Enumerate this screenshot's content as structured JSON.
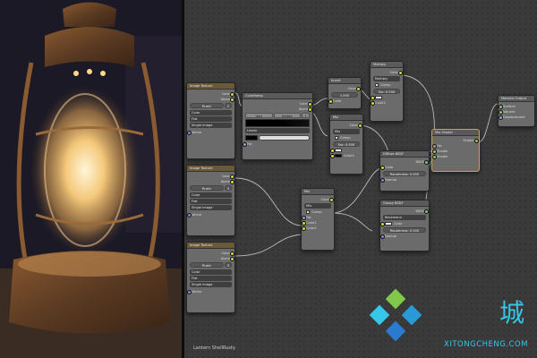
{
  "colors": {
    "editor_bg": "#3a3a3a",
    "node_body": "#6b6b6b",
    "socket_color": "#d8d83b",
    "socket_shader": "#8ac57a",
    "socket_vector": "#7a8ad8",
    "active_outline": "#e19a3a",
    "wire": "#cfcfcf",
    "watermark": "#35c6e8"
  },
  "icons": {
    "photo": "oil-lantern-photo",
    "logo": "xitongcheng-diamond-logo"
  },
  "frame_label": "Lantern ShellRusty",
  "nodes": {
    "image_texture_1": {
      "title": "Image Texture",
      "outputs": [
        "Color",
        "Alpha"
      ],
      "image_field": "Rusty",
      "count": "2",
      "selects": [
        "Color",
        "Flat",
        "Single Image"
      ],
      "input": "Vector"
    },
    "image_texture_2": {
      "title": "Image Texture",
      "outputs": [
        "Color",
        "Alpha"
      ],
      "image_field": "Rusty",
      "count": "3",
      "selects": [
        "Color",
        "Flat",
        "Single Image"
      ],
      "input": "Vector"
    },
    "image_texture_3": {
      "title": "Image Texture",
      "outputs": [
        "Color",
        "Alpha"
      ],
      "image_field": "Rusty",
      "count": "3",
      "selects": [
        "Color",
        "Flat",
        "Single Image"
      ],
      "input": "Vector"
    },
    "color_ramp": {
      "title": "ColorRamp",
      "outputs": [
        "Color",
        "Alpha"
      ],
      "add": "Add",
      "delete": "Delete",
      "flip": "F",
      "interp": "Linear",
      "input": "Fac"
    },
    "invert": {
      "title": "Invert",
      "output": "Color",
      "fac": "1.000",
      "input": "Color"
    },
    "mix_top": {
      "title": "Mix",
      "output": "Color",
      "mode": "Mix",
      "clamp": "Clamp",
      "fac": "Fac: 0.550",
      "inputs": [
        "Color1",
        "Color2"
      ]
    },
    "multiply": {
      "title": "Multiply",
      "output": "Color",
      "mode": "Multiply",
      "clamp": "Clamp",
      "fac": "Fac: 0.550",
      "inputs": [
        "Color1",
        "Color2"
      ]
    },
    "mix_bottom": {
      "title": "Mix",
      "output": "Color",
      "mode": "Mix",
      "clamp": "Clamp",
      "inputs": [
        "Fac",
        "Color1",
        "Color2"
      ]
    },
    "diffuse": {
      "title": "Diffuse BSDF",
      "output": "BSDF",
      "roughness": "Roughness: 0.000",
      "inputs": [
        "Color",
        "Normal"
      ]
    },
    "glossy": {
      "title": "Glossy BSDF",
      "output": "BSDF",
      "mode": "Beckmann",
      "roughness": "Roughness: 0.200",
      "inputs": [
        "Color",
        "Normal"
      ]
    },
    "mix_shader": {
      "title": "Mix Shader",
      "output": "Shader",
      "inputs": [
        "Fac",
        "Shader",
        "Shader"
      ]
    },
    "material_output": {
      "title": "Material Output",
      "inputs": [
        "Surface",
        "Volume",
        "Displacement"
      ]
    }
  },
  "watermark": {
    "char": "城",
    "text": "XITONGCHENG.COM"
  }
}
